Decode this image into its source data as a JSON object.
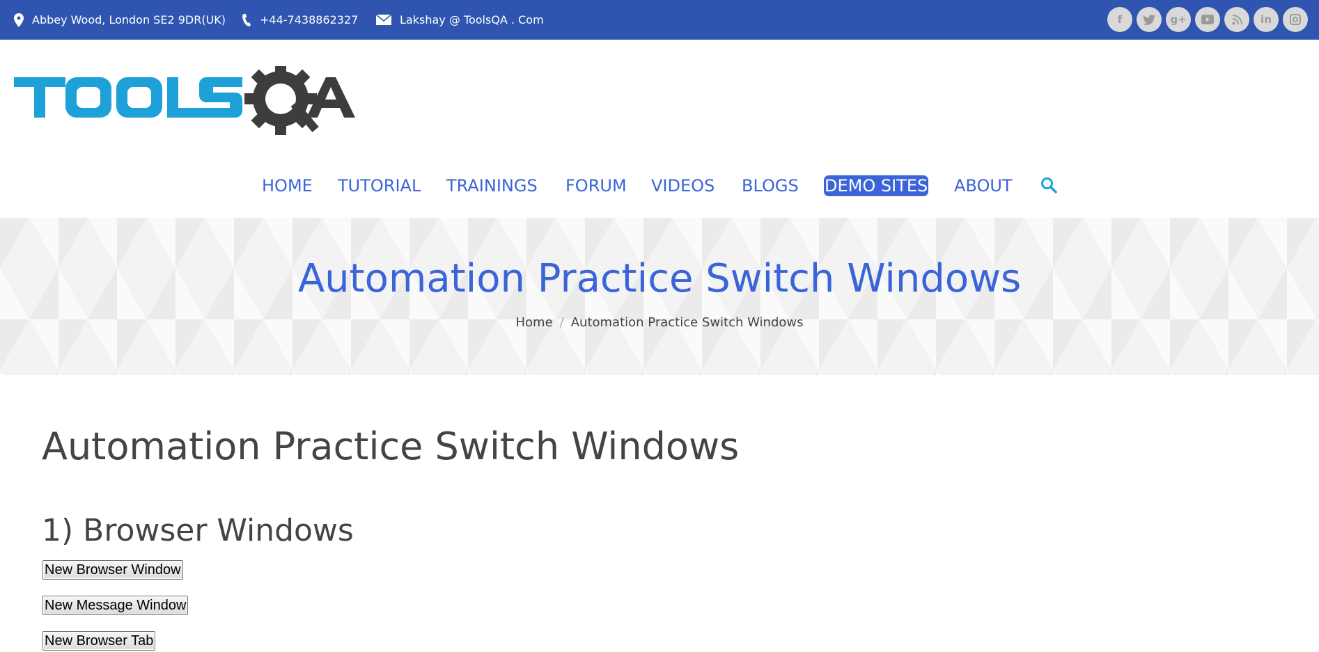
{
  "topbar": {
    "address": "Abbey Wood, London SE2 9DR(UK)",
    "phone": "+44-7438862327",
    "email": "Lakshay @ ToolsQA . Com",
    "socials": [
      "facebook-icon",
      "twitter-icon",
      "google-plus-icon",
      "youtube-icon",
      "rss-icon",
      "linkedin-icon",
      "instagram-icon"
    ]
  },
  "logo": {
    "text": "TOOLSQA"
  },
  "nav": {
    "items": [
      "HOME",
      "TUTORIAL",
      "TRAININGS",
      "FORUM",
      "VIDEOS",
      "BLOGS",
      "DEMO SITES",
      "ABOUT"
    ],
    "active": "DEMO SITES"
  },
  "banner": {
    "title": "Automation Practice Switch Windows",
    "breadcrumb_home": "Home",
    "breadcrumb_sep": "/",
    "breadcrumb_current": "Automation Practice Switch Windows"
  },
  "main": {
    "title": "Automation Practice Switch Windows",
    "section1": "1) Browser Windows",
    "buttons": [
      "New Browser Window",
      "New Message Window",
      "New Browser Tab"
    ]
  },
  "colors": {
    "topbar": "#2f55b0",
    "accent": "#3a64d8",
    "logo_blue": "#1da1d8",
    "logo_dark": "#3d3d3d"
  }
}
